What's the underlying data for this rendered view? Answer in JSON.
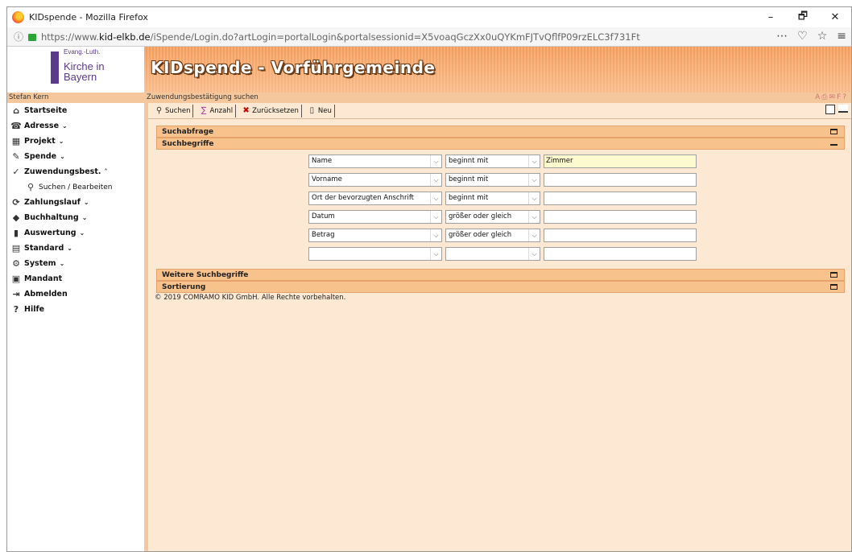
{
  "browser": {
    "title": "KIDspende - Mozilla Firefox",
    "url_prefix": "https://www.",
    "url_domain": "kid-elkb.de",
    "url_path": "/iSpende/Login.do?artLogin=portalLogin&portalsessionid=X5voaqGczXx0uQYKmFJTvQflfP09rzELC3f731Ft",
    "controls": [
      "–",
      "🗗",
      "✕"
    ]
  },
  "logo": {
    "line1": "Evang.-Luth.",
    "line2": "Kirche in",
    "line3": "Bayern"
  },
  "app_title": "KIDspende - Vorführgemeinde",
  "user": "Stefan Kern",
  "breadcrumb": "Zuwendungsbestätigung suchen",
  "sidebar": {
    "items": [
      {
        "label": "Startseite",
        "icon": "home-icon",
        "glyph": "⌂",
        "caret": ""
      },
      {
        "label": "Adresse",
        "icon": "address-icon",
        "glyph": "☎",
        "caret": "⌄"
      },
      {
        "label": "Projekt",
        "icon": "project-icon",
        "glyph": "▦",
        "caret": "⌄"
      },
      {
        "label": "Spende",
        "icon": "donation-icon",
        "glyph": "✎",
        "caret": "⌄"
      },
      {
        "label": "Zuwendungsbest.",
        "icon": "receipt-icon",
        "glyph": "✓",
        "caret": "˄"
      },
      {
        "label": "Suchen / Bearbeiten",
        "icon": "binoculars-icon",
        "glyph": "⚲",
        "caret": ""
      },
      {
        "label": "Zahlungslauf",
        "icon": "payment-run-icon",
        "glyph": "⟳",
        "caret": "⌄"
      },
      {
        "label": "Buchhaltung",
        "icon": "accounting-icon",
        "glyph": "◆",
        "caret": "⌄"
      },
      {
        "label": "Auswertung",
        "icon": "chart-icon",
        "glyph": "▮",
        "caret": "⌄"
      },
      {
        "label": "Standard",
        "icon": "standard-icon",
        "glyph": "▤",
        "caret": "⌄"
      },
      {
        "label": "System",
        "icon": "gear-icon",
        "glyph": "⚙",
        "caret": "⌄"
      },
      {
        "label": "Mandant",
        "icon": "client-icon",
        "glyph": "▣",
        "caret": ""
      },
      {
        "label": "Abmelden",
        "icon": "logout-icon",
        "glyph": "⇥",
        "caret": ""
      },
      {
        "label": "Hilfe",
        "icon": "help-icon",
        "glyph": "?",
        "caret": ""
      }
    ]
  },
  "toolbar": {
    "search": "Suchen",
    "count": "Anzahl",
    "reset": "Zurücksetzen",
    "new": "Neu"
  },
  "sections": {
    "query": "Suchabfrage",
    "criteria": "Suchbegriffe",
    "more": "Weitere Suchbegriffe",
    "sort": "Sortierung"
  },
  "criteria_rows": [
    {
      "field": "Name",
      "op": "beginnt mit",
      "value": "Zimmer"
    },
    {
      "field": "Vorname",
      "op": "beginnt mit",
      "value": ""
    },
    {
      "field": "Ort der bevorzugten Anschrift",
      "op": "beginnt mit",
      "value": ""
    },
    {
      "field": "Datum",
      "op": "größer oder gleich",
      "value": ""
    },
    {
      "field": "Betrag",
      "op": "größer oder gleich",
      "value": ""
    },
    {
      "field": "",
      "op": "",
      "value": ""
    }
  ],
  "footer": "© 2019 COMRAMO KID GmbH. Alle Rechte vorbehalten.",
  "colors": {
    "accent": "#f39b5c",
    "page_bg": "#fde9d3",
    "section": "#f8c28d"
  }
}
